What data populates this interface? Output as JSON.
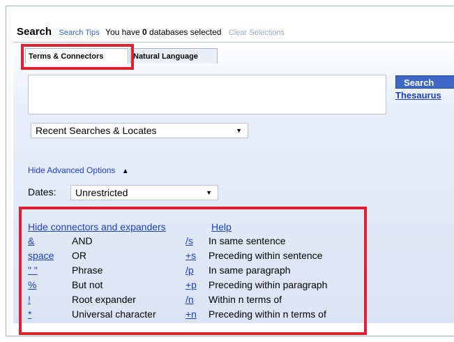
{
  "header": {
    "title": "Search",
    "search_tips": "Search Tips",
    "msg_prefix": "You have",
    "db_count": "0",
    "msg_suffix": "databases selected",
    "clear_selections": "Clear Selections"
  },
  "tabs": [
    {
      "label": "Terms & Connectors",
      "selected": true
    },
    {
      "label": "Natural Language",
      "selected": false
    }
  ],
  "query_input": {
    "value": ""
  },
  "buttons": {
    "search": "Search",
    "thesaurus": "Thesaurus"
  },
  "recent_dropdown": {
    "value": "Recent Searches & Locates"
  },
  "advanced": {
    "toggle_label": "Hide Advanced Options",
    "dates_label": "Dates:",
    "dates_value": "Unrestricted"
  },
  "connectors": {
    "hide_label": "Hide connectors and expanders",
    "help_label": "Help",
    "rows": [
      {
        "sym": "&",
        "desc": "AND",
        "sym2": "/s",
        "desc2": "In same sentence"
      },
      {
        "sym": "space",
        "desc": "OR",
        "sym2": "+s",
        "desc2": "Preceding within sentence"
      },
      {
        "sym": "\" \"",
        "desc": "Phrase",
        "sym2": "/p",
        "desc2": "In same paragraph"
      },
      {
        "sym": "%",
        "desc": "But not",
        "sym2": "+p",
        "desc2": "Preceding within paragraph"
      },
      {
        "sym": "!",
        "desc": "Root expander",
        "sym2": "/n",
        "desc2": "Within n terms of"
      },
      {
        "sym": "*",
        "desc": "Universal character",
        "sym2": "+n",
        "desc2": "Preceding within n terms of"
      }
    ]
  },
  "colors": {
    "link": "#1a3fcc",
    "search_button": "#3d68c8",
    "highlight": "#e0202e"
  }
}
